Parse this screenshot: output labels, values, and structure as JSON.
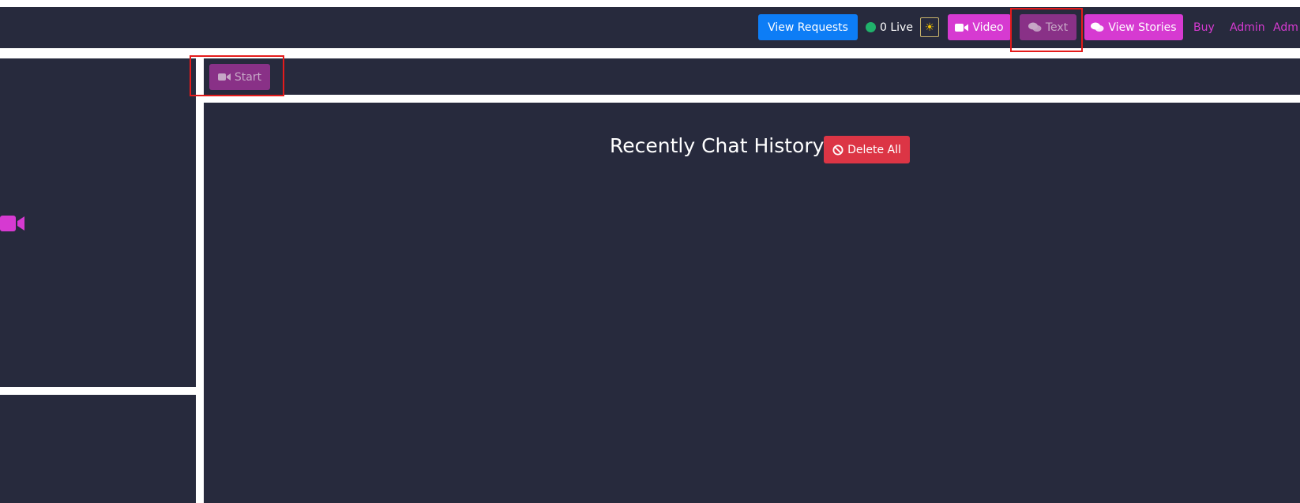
{
  "navbar": {
    "view_requests": "View Requests",
    "live_status": "0 Live",
    "video": "Video",
    "text": "Text",
    "view_stories": "View Stories",
    "buy": "Buy",
    "admin_1": "Admin",
    "admin_2": "Adm"
  },
  "toolbar": {
    "start": "Start"
  },
  "main": {
    "title": "Recently Chat History",
    "delete_all": "Delete All"
  },
  "colors": {
    "panel_bg": "#272a3d",
    "accent_magenta": "#d63ad1",
    "accent_magenta_disabled": "#893187",
    "primary_blue": "#0d7df6",
    "danger_red": "#dc3545",
    "live_green": "#20b26b"
  },
  "icons": [
    "video-camera-icon",
    "chat-bubbles-icon",
    "sun-icon",
    "ban-icon",
    "live-dot-icon"
  ]
}
